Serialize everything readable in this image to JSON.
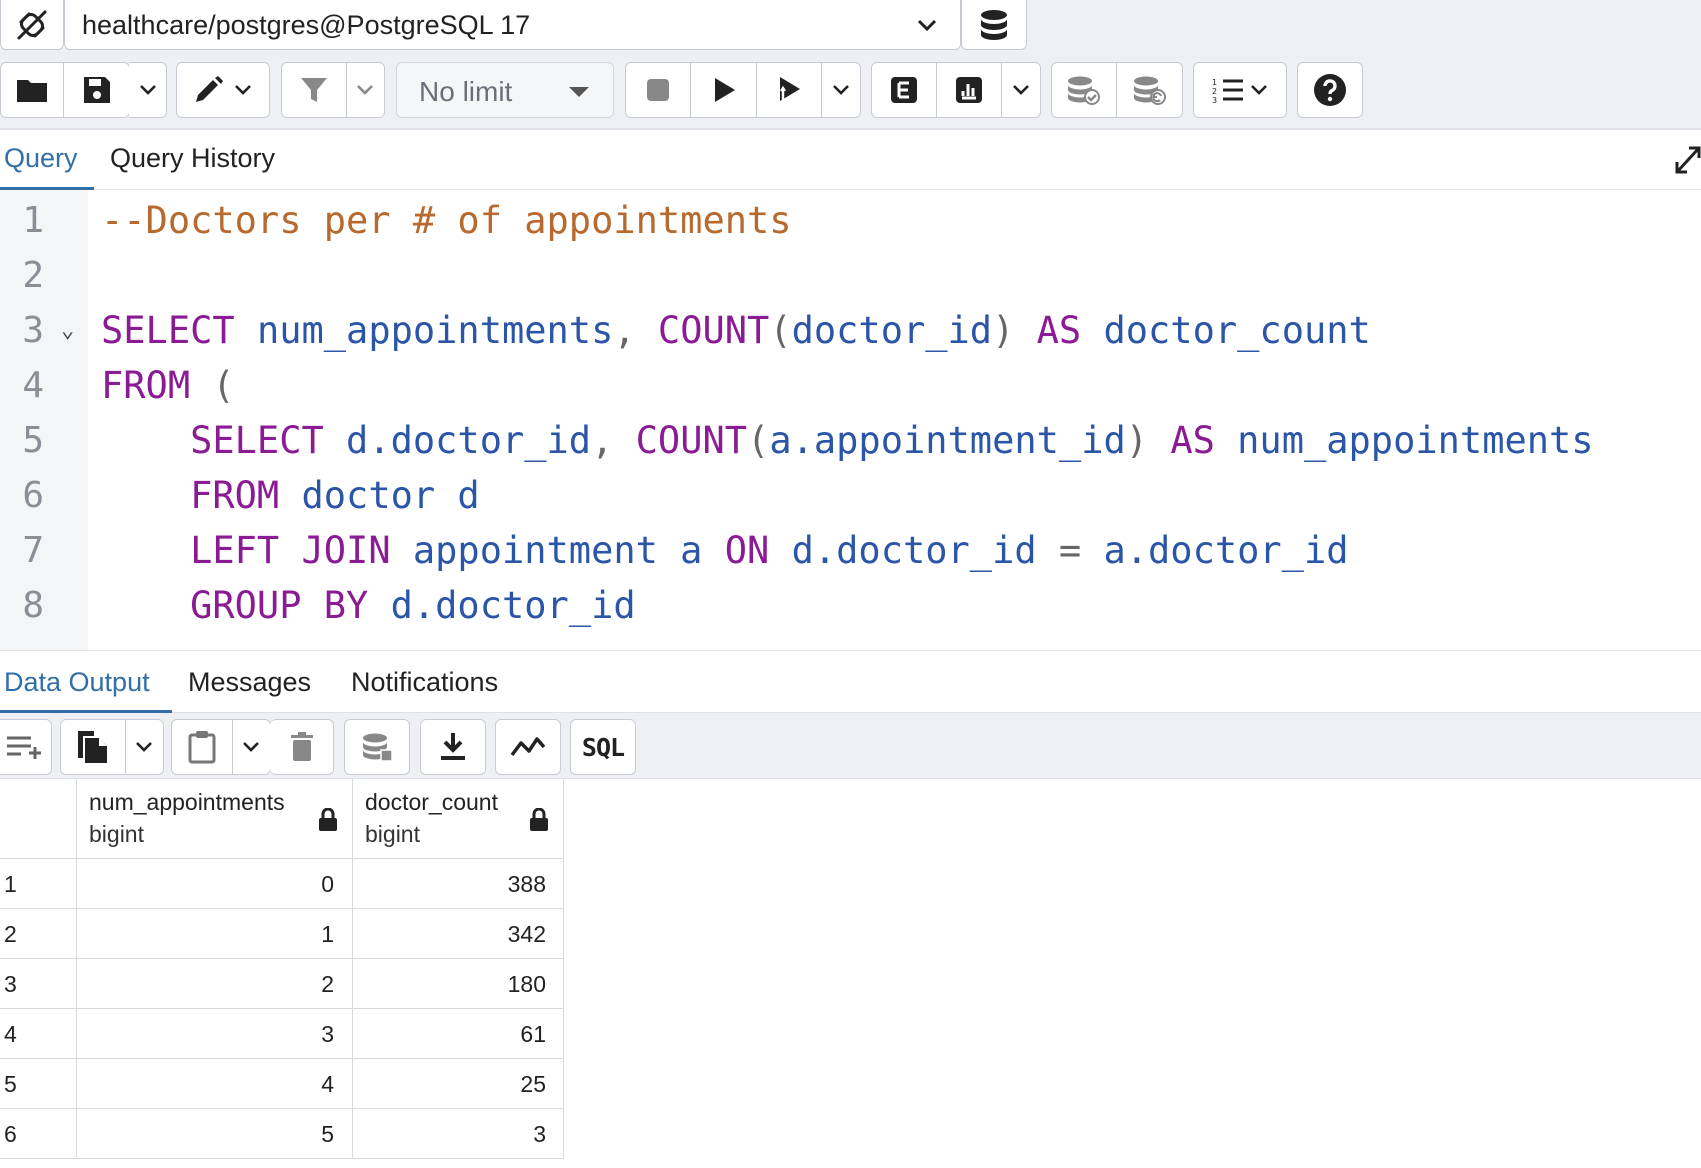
{
  "connection": {
    "label": "healthcare/postgres@PostgreSQL 17"
  },
  "toolbar": {
    "limit_label": "No limit",
    "buttons": [
      "folder-icon",
      "save-icon",
      "chevron-down-icon",
      "pen-icon",
      "filter-icon",
      "stop-icon",
      "play-icon",
      "play-line-icon",
      "explain-icon",
      "analyze-icon",
      "commit-icon",
      "rollback-icon",
      "macros-icon",
      "help-icon"
    ]
  },
  "query_tabs": [
    {
      "label": "Query",
      "active": true
    },
    {
      "label": "Query History",
      "active": false
    }
  ],
  "editor": {
    "lines": [
      {
        "n": "1",
        "tokens": [
          {
            "t": "--Doctors per # of appointments",
            "c": "cm"
          }
        ]
      },
      {
        "n": "2",
        "tokens": []
      },
      {
        "n": "3",
        "fold": "⌄",
        "tokens": [
          {
            "t": "SELECT",
            "c": "kw"
          },
          {
            "t": " ",
            "c": "pn"
          },
          {
            "t": "num_appointments",
            "c": "id"
          },
          {
            "t": ", ",
            "c": "pn"
          },
          {
            "t": "COUNT",
            "c": "kw"
          },
          {
            "t": "(",
            "c": "pn"
          },
          {
            "t": "doctor_id",
            "c": "id"
          },
          {
            "t": ") ",
            "c": "pn"
          },
          {
            "t": "AS",
            "c": "kw"
          },
          {
            "t": " ",
            "c": "pn"
          },
          {
            "t": "doctor_count",
            "c": "id"
          }
        ]
      },
      {
        "n": "4",
        "tokens": [
          {
            "t": "FROM",
            "c": "kw"
          },
          {
            "t": " (",
            "c": "pn"
          }
        ]
      },
      {
        "n": "5",
        "tokens": [
          {
            "t": "    ",
            "c": "pn"
          },
          {
            "t": "SELECT",
            "c": "kw"
          },
          {
            "t": " ",
            "c": "pn"
          },
          {
            "t": "d.doctor_id",
            "c": "id"
          },
          {
            "t": ", ",
            "c": "pn"
          },
          {
            "t": "COUNT",
            "c": "kw"
          },
          {
            "t": "(",
            "c": "pn"
          },
          {
            "t": "a.appointment_id",
            "c": "id"
          },
          {
            "t": ") ",
            "c": "pn"
          },
          {
            "t": "AS",
            "c": "kw"
          },
          {
            "t": " ",
            "c": "pn"
          },
          {
            "t": "num_appointments",
            "c": "id"
          }
        ]
      },
      {
        "n": "6",
        "tokens": [
          {
            "t": "    ",
            "c": "pn"
          },
          {
            "t": "FROM",
            "c": "kw"
          },
          {
            "t": " ",
            "c": "pn"
          },
          {
            "t": "doctor d",
            "c": "id"
          }
        ]
      },
      {
        "n": "7",
        "tokens": [
          {
            "t": "    ",
            "c": "pn"
          },
          {
            "t": "LEFT JOIN",
            "c": "kw"
          },
          {
            "t": " ",
            "c": "pn"
          },
          {
            "t": "appointment a",
            "c": "id"
          },
          {
            "t": " ",
            "c": "pn"
          },
          {
            "t": "ON",
            "c": "kw"
          },
          {
            "t": " ",
            "c": "pn"
          },
          {
            "t": "d.doctor_id",
            "c": "id"
          },
          {
            "t": " = ",
            "c": "pn"
          },
          {
            "t": "a.doctor_id",
            "c": "id"
          }
        ]
      },
      {
        "n": "8",
        "tokens": [
          {
            "t": "    ",
            "c": "pn"
          },
          {
            "t": "GROUP BY",
            "c": "kw"
          },
          {
            "t": " ",
            "c": "pn"
          },
          {
            "t": "d.doctor_id",
            "c": "id"
          }
        ]
      }
    ]
  },
  "output_tabs": [
    {
      "label": "Data Output",
      "active": true
    },
    {
      "label": "Messages",
      "active": false
    },
    {
      "label": "Notifications",
      "active": false
    }
  ],
  "output_toolbar": {
    "sql_label": "SQL"
  },
  "grid": {
    "columns": [
      {
        "name": "num_appointments",
        "type": "bigint"
      },
      {
        "name": "doctor_count",
        "type": "bigint"
      }
    ],
    "rows": [
      {
        "n": "1",
        "num_appointments": "0",
        "doctor_count": "388"
      },
      {
        "n": "2",
        "num_appointments": "1",
        "doctor_count": "342"
      },
      {
        "n": "3",
        "num_appointments": "2",
        "doctor_count": "180"
      },
      {
        "n": "4",
        "num_appointments": "3",
        "doctor_count": "61"
      },
      {
        "n": "5",
        "num_appointments": "4",
        "doctor_count": "25"
      },
      {
        "n": "6",
        "num_appointments": "5",
        "doctor_count": "3"
      }
    ]
  },
  "colors": {
    "accent": "#326fa8",
    "keyword": "#8b1a95",
    "identifier": "#2b56a8",
    "comment": "#b7692e"
  }
}
